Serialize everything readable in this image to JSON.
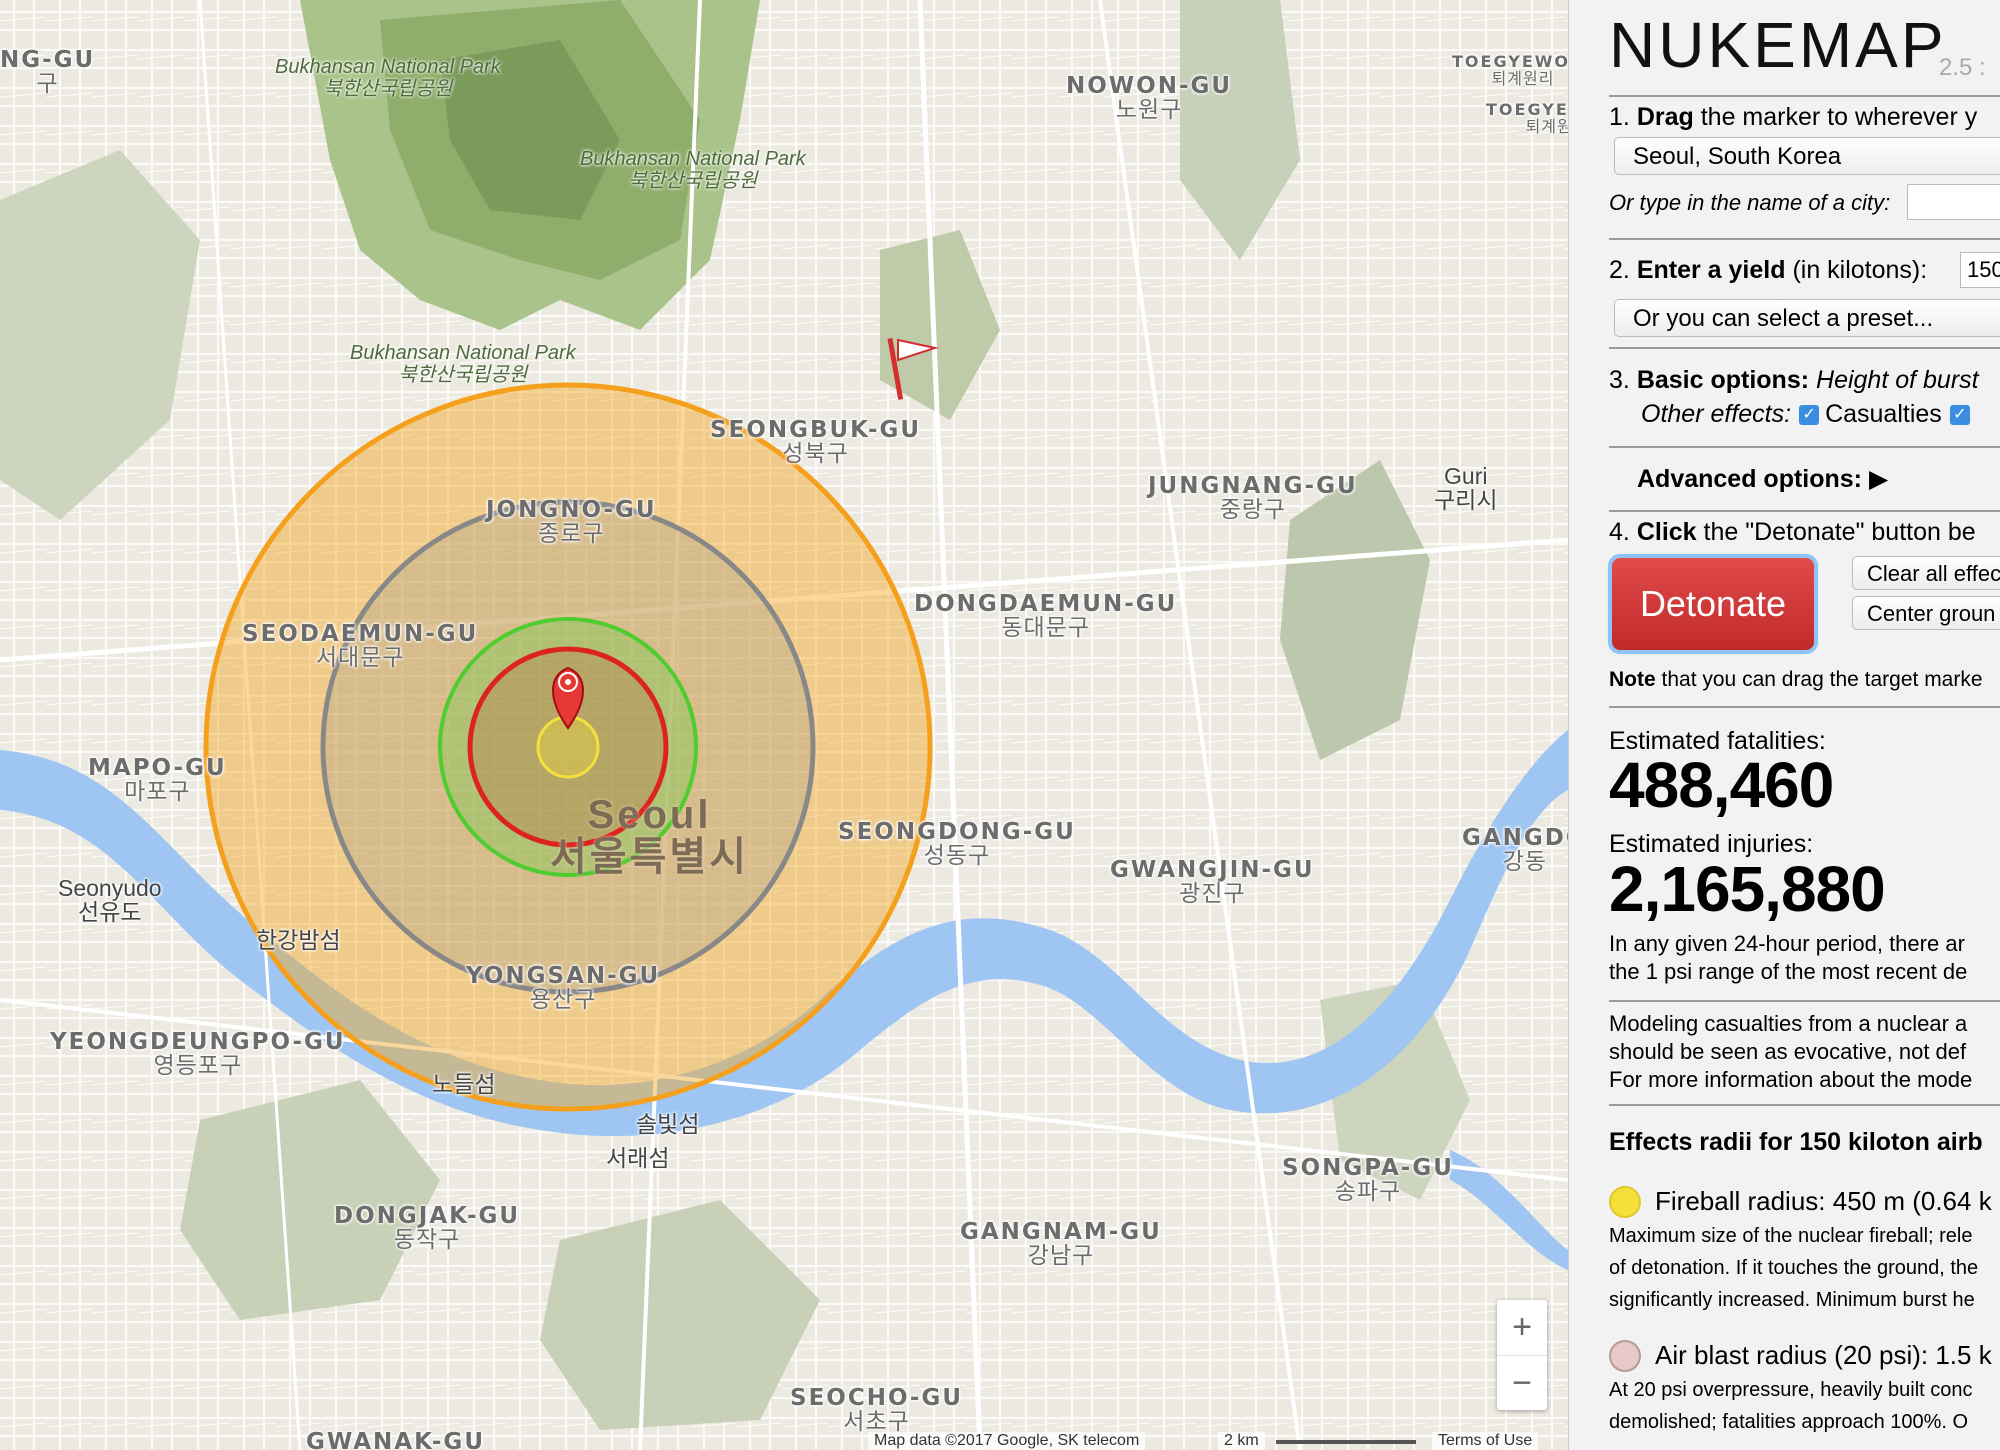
{
  "map": {
    "parks": [
      {
        "en": "Bukhansan National Park",
        "ko": "북한산국립공원"
      },
      {
        "en": "Bukhansan National Park",
        "ko": "북한산국립공원"
      },
      {
        "en": "Bukhansan National Park",
        "ko": "북한산국립공원"
      }
    ],
    "districts": [
      {
        "en": "NG-GU",
        "ko": "구"
      },
      {
        "en": "NOWON-GU",
        "ko": "노원구"
      },
      {
        "en": "TOEGYEWON-",
        "ko": "퇴계원리"
      },
      {
        "en": "TOEGYEWON-",
        "ko": "퇴계원면"
      },
      {
        "en": "SEONGBUK-GU",
        "ko": "성북구"
      },
      {
        "en": "JONGNO-GU",
        "ko": "종로구"
      },
      {
        "en": "JUNGNANG-GU",
        "ko": "중랑구"
      },
      {
        "en": "DONGDAEMUN-GU",
        "ko": "동대문구"
      },
      {
        "en": "SEODAEMUN-GU",
        "ko": "서대문구"
      },
      {
        "en": "MAPO-GU",
        "ko": "마포구"
      },
      {
        "en": "SEONGDONG-GU",
        "ko": "성동구"
      },
      {
        "en": "GWANGJIN-GU",
        "ko": "광진구"
      },
      {
        "en": "GANGDO",
        "ko": "강동"
      },
      {
        "en": "YONGSAN-GU",
        "ko": "용산구"
      },
      {
        "en": "YEONGDEUNGPO-GU",
        "ko": "영등포구"
      },
      {
        "en": "DONGJAK-GU",
        "ko": "동작구"
      },
      {
        "en": "GANGNAM-GU",
        "ko": "강남구"
      },
      {
        "en": "SONGPA-GU",
        "ko": "송파구"
      },
      {
        "en": "SEOCHO-GU",
        "ko": "서초구"
      },
      {
        "en": "GWANAK-GU",
        "ko": ""
      }
    ],
    "places": [
      {
        "en": "Guri",
        "ko": "구리시"
      },
      {
        "en": "Seonyudo",
        "ko": "선유도"
      },
      {
        "en": "",
        "ko": "한강밤섬"
      },
      {
        "en": "",
        "ko": "노들섬"
      },
      {
        "en": "",
        "ko": "솔빛섬"
      },
      {
        "en": "",
        "ko": "서래섬"
      }
    ],
    "seoul": {
      "en": "Seoul",
      "ko": "서울특별시"
    },
    "zoom_in": "+",
    "zoom_out": "−",
    "attribution": "Map data ©2017 Google, SK telecom",
    "scale_label": "2 km",
    "terms": "Terms of Use",
    "colors": {
      "fireball": "#f4e03a",
      "air_blast": "#dd2222",
      "radiation": "#55cc33",
      "moderate_blast": "#888888",
      "thermal": "#f5a623",
      "water": "#9fc6f3"
    }
  },
  "panel": {
    "title": "NUKEMAP",
    "version": "2.5 :",
    "step1_num": "1.",
    "step1_bold": "Drag",
    "step1_rest": "the marker to wherever y",
    "location_value": "Seoul, South Korea",
    "city_prompt": "Or type in the name of a city:",
    "city_input": "",
    "step2_num": "2.",
    "step2_bold": "Enter a yield",
    "step2_rest": "(in kilotons):",
    "yield_value": "150",
    "preset_label": "Or you can select a preset...",
    "step3_num": "3.",
    "step3_bold": "Basic options:",
    "step3_rest": "Height of burst",
    "other_effects": "Other effects:",
    "casualties_label": "Casualties",
    "check_mark": "✓",
    "advanced_label": "Advanced options:",
    "advanced_arrow": "▶",
    "step4_num": "4.",
    "step4_bold": "Click",
    "step4_rest": "the \"Detonate\" button be",
    "detonate": "Detonate",
    "clear_button": "Clear all effec",
    "center_button": "Center groun",
    "note_bold": "Note",
    "note_rest": "that you can drag the target marke",
    "fatalities_label": "Estimated fatalities:",
    "fatalities_value": "488,460",
    "injuries_label": "Estimated injuries:",
    "injuries_value": "2,165,880",
    "period_line1": "In any given 24-hour period, there ar",
    "period_line2": "the 1 psi range of the most recent de",
    "model_line1": "Modeling casualties from a nuclear a",
    "model_line2": "should be seen as evocative, not def",
    "model_line3": "For more information about the mode",
    "effects_heading": "Effects radii for 150 kiloton airb",
    "fireball_label": "Fireball radius: 450 m (0.64 k",
    "fireball_desc1": "Maximum size of the nuclear fireball; rele",
    "fireball_desc2": "of detonation. If it touches the ground, the",
    "fireball_desc3": "significantly increased. Minimum burst he",
    "airblast_label": "Air blast radius (20 psi): 1.5 k",
    "airblast_desc1": "At 20 psi overpressure, heavily built conc",
    "airblast_desc2": "demolished; fatalities approach 100%. O"
  }
}
